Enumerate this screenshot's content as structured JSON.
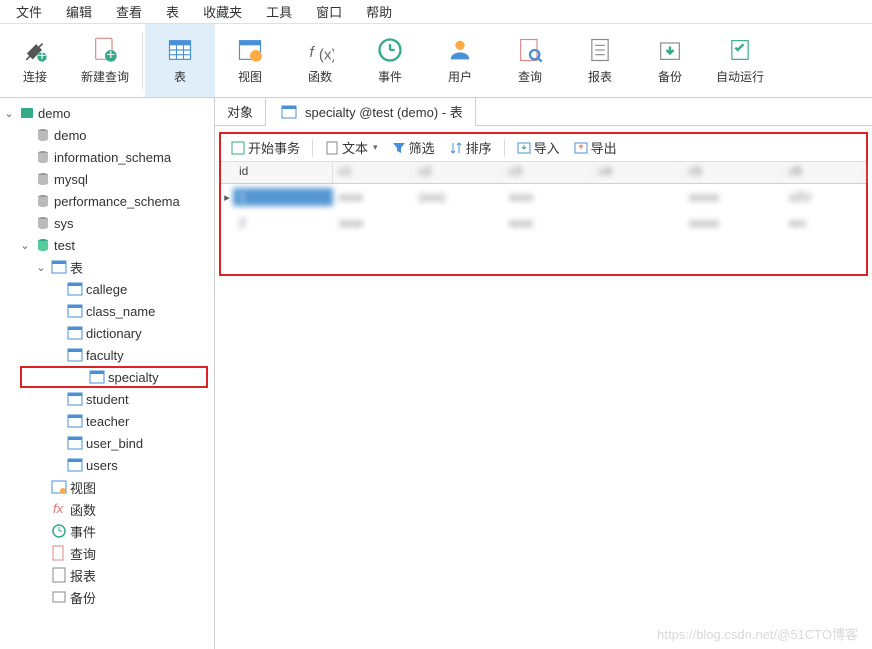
{
  "menu": [
    "文件",
    "编辑",
    "查看",
    "表",
    "收藏夹",
    "工具",
    "窗口",
    "帮助"
  ],
  "toolbar": [
    {
      "id": "connection",
      "label": "连接"
    },
    {
      "id": "new-query",
      "label": "新建查询"
    },
    {
      "id": "table",
      "label": "表",
      "active": true
    },
    {
      "id": "view",
      "label": "视图"
    },
    {
      "id": "function",
      "label": "函数"
    },
    {
      "id": "event",
      "label": "事件"
    },
    {
      "id": "user",
      "label": "用户"
    },
    {
      "id": "query",
      "label": "查询"
    },
    {
      "id": "report",
      "label": "报表"
    },
    {
      "id": "backup",
      "label": "备份"
    },
    {
      "id": "autorun",
      "label": "自动运行"
    }
  ],
  "tree": {
    "conn": "demo",
    "dbs": [
      "demo",
      "information_schema",
      "mysql",
      "performance_schema",
      "sys"
    ],
    "testdb": "test",
    "tablesLabel": "表",
    "tables": [
      "callege",
      "class_name",
      "dictionary",
      "faculty",
      "specialty",
      "student",
      "teacher",
      "user_bind",
      "users"
    ],
    "other": [
      {
        "id": "views",
        "label": "视图"
      },
      {
        "id": "functions",
        "label": "函数"
      },
      {
        "id": "events",
        "label": "事件"
      },
      {
        "id": "queries",
        "label": "查询"
      },
      {
        "id": "reports",
        "label": "报表"
      },
      {
        "id": "backups",
        "label": "备份"
      }
    ]
  },
  "tabs": {
    "objects": "对象",
    "current": "specialty @test (demo) - 表"
  },
  "subtb": {
    "begin": "开始事务",
    "text": "文本",
    "filter": "筛选",
    "sort": "排序",
    "import": "导入",
    "export": "导出"
  },
  "grid": {
    "cols": [
      "id",
      "c1",
      "c2",
      "c3",
      "c4",
      "c5",
      "c6"
    ],
    "widths": [
      100,
      80,
      90,
      90,
      90,
      100,
      80
    ],
    "rows": [
      [
        "1",
        "xxxx",
        "(xxx)",
        "xxxx",
        "",
        "xxxxx",
        "xZU"
      ],
      [
        "2",
        "xxxx",
        "",
        "xxxx",
        "",
        "xxxxx",
        "xro"
      ]
    ]
  },
  "watermark": "https://blog.csdn.net/@51CTO博客"
}
